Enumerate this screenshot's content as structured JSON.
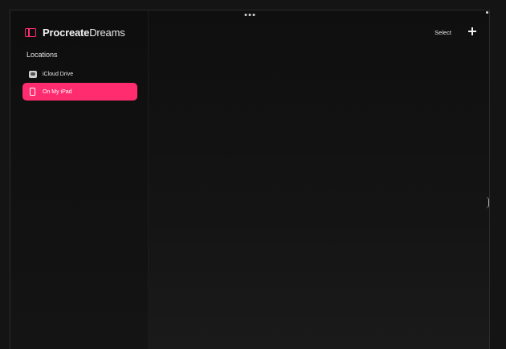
{
  "app": {
    "brand_bold": "Procreate",
    "brand_light": "Dreams"
  },
  "sidebar": {
    "section_title": "Locations",
    "locations": [
      {
        "label": "iCloud Drive",
        "icon": "cloud-drive-icon",
        "selected": false
      },
      {
        "label": "On My iPad",
        "icon": "ipad-icon",
        "selected": true
      }
    ]
  },
  "toolbar": {
    "select_label": "Select",
    "add_icon": "plus-icon"
  },
  "colors": {
    "accent": "#ff2d6f",
    "background": "#141414",
    "text": "#e6e6e6"
  }
}
